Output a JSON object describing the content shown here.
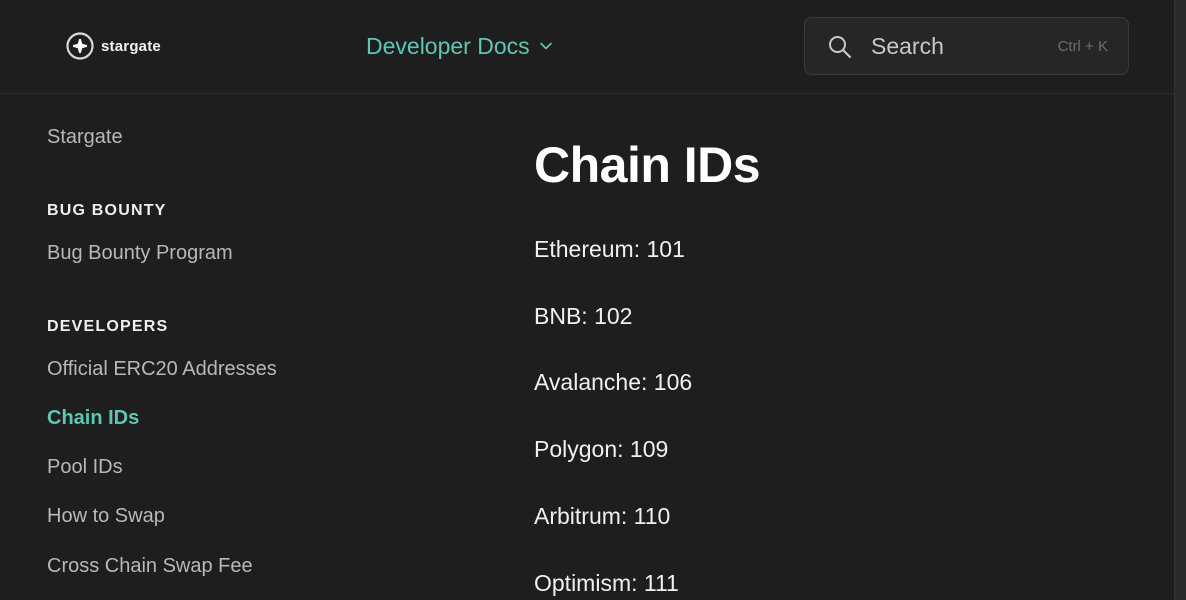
{
  "header": {
    "logo_text": "stargate",
    "docs_switcher_label": "Developer Docs",
    "search": {
      "label": "Search",
      "shortcut": "Ctrl + K"
    }
  },
  "sidebar": {
    "top_link": "Stargate",
    "sections": [
      {
        "heading": "BUG BOUNTY",
        "items": [
          "Bug Bounty Program"
        ]
      },
      {
        "heading": "DEVELOPERS",
        "items": [
          "Official ERC20 Addresses",
          "Chain IDs",
          "Pool IDs",
          "How to Swap",
          "Cross Chain Swap Fee"
        ]
      }
    ],
    "active_item": "Chain IDs"
  },
  "main": {
    "title": "Chain IDs",
    "chains": [
      "Ethereum: 101",
      "BNB: 102",
      "Avalanche: 106",
      "Polygon: 109",
      "Arbitrum: 110",
      "Optimism: 111"
    ]
  },
  "colors": {
    "accent": "#5fc6b2",
    "background": "#1e1e1e",
    "search_bg": "#262626"
  }
}
